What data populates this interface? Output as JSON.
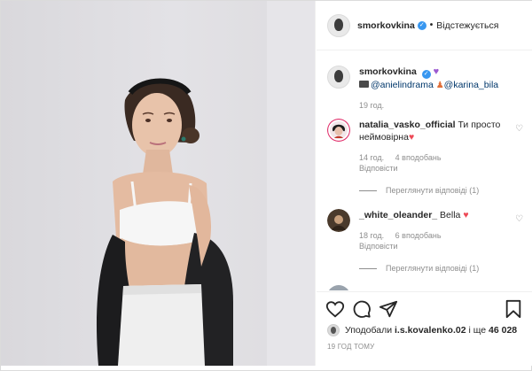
{
  "header": {
    "username": "smorkovkina",
    "follow_state": "Відстежується"
  },
  "caption": {
    "username": "smorkovkina",
    "mention_1": "@anielindrama",
    "mention_2": "@karina_bila",
    "time": "19 год."
  },
  "comments": [
    {
      "username": "natalia_vasko_official",
      "text": "Ти просто неймовірна",
      "time": "14 год.",
      "likes": "4 вподобань",
      "reply": "Відповісти",
      "view_replies": "Переглянути відповіді (1)"
    },
    {
      "username": "_white_oleander_",
      "text": "Bella",
      "time": "18 год.",
      "likes": "6 вподобань",
      "reply": "Відповісти",
      "view_replies": "Переглянути відповіді (1)"
    }
  ],
  "actions": {
    "liked_by_prefix": "Уподобали",
    "liked_by_user": "i.s.kovalenko.02",
    "liked_by_and": "і ще",
    "liked_by_count": "46 028",
    "post_time": "19 ГОД ТОМУ"
  },
  "colors": {
    "link": "#00376b",
    "muted": "#8e8e8e",
    "verified": "#3897f0",
    "heart": "#ed4956"
  },
  "icons": [
    "verified-badge-icon",
    "heart-icon",
    "comment-icon",
    "share-icon",
    "bookmark-icon"
  ]
}
